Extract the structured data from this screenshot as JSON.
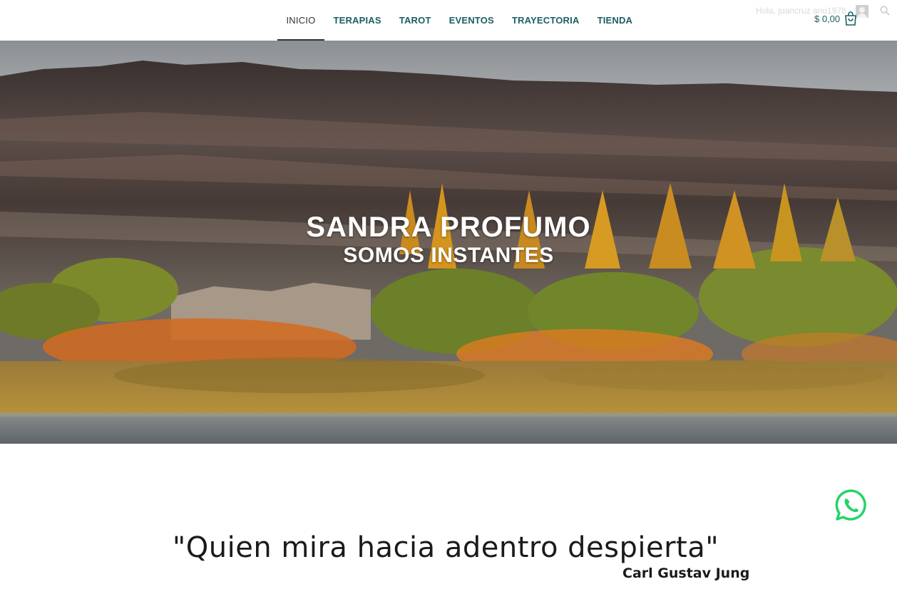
{
  "nav": {
    "items": [
      {
        "label": "INICIO",
        "active": true
      },
      {
        "label": "TERAPIAS"
      },
      {
        "label": "TAROT"
      },
      {
        "label": "EVENTOS"
      },
      {
        "label": "TRAYECTORIA"
      },
      {
        "label": "TIENDA"
      }
    ]
  },
  "header": {
    "greeting": "Hola, juancruz ario1978",
    "cart_total": "$ 0,00",
    "icons": {
      "avatar": "user-avatar-icon",
      "cart": "shopping-bag-icon",
      "search": "search-icon"
    }
  },
  "hero": {
    "title": "SANDRA PROFUMO",
    "subtitle": "SOMOS INSTANTES"
  },
  "quote": {
    "text": "\"Quien mira hacia adentro despierta\"",
    "author": "Carl Gustav Jung"
  },
  "floating": {
    "icon": "whatsapp-icon",
    "color": "#25d366"
  },
  "colors": {
    "nav_text": "#1b5e63",
    "active_nav": "#333333",
    "whatsapp": "#25d366"
  }
}
